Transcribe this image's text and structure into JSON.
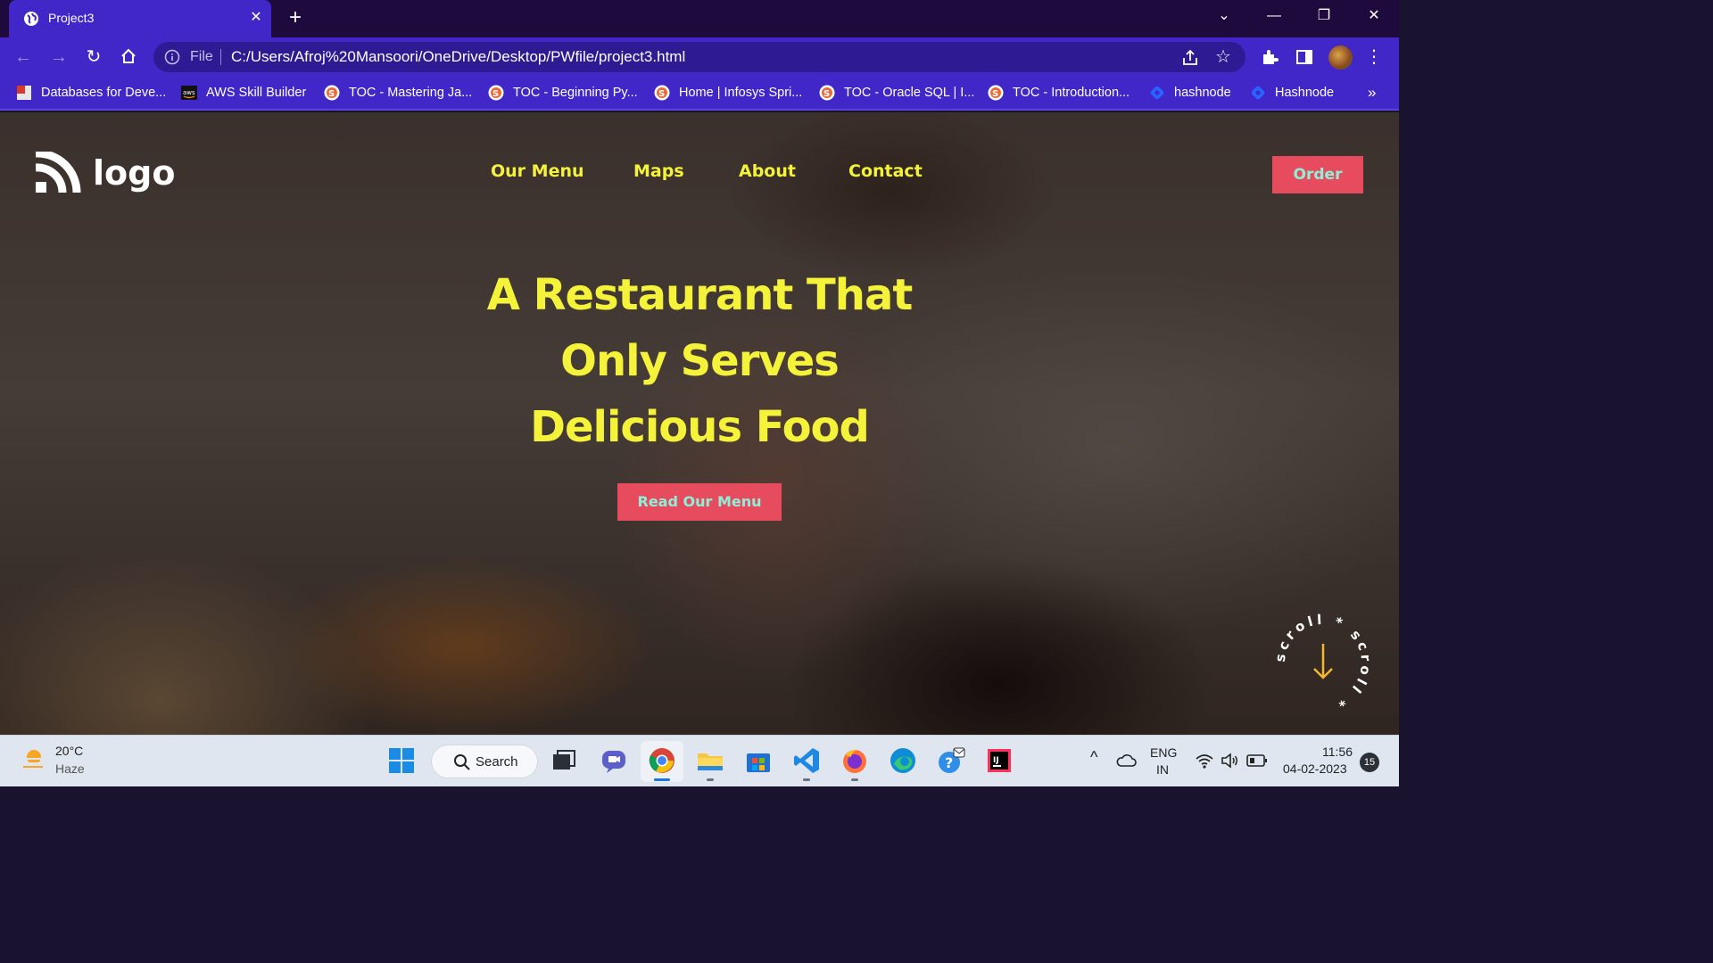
{
  "browser": {
    "tab_title": "Project3",
    "address_prefix": "File",
    "url": "C:/Users/Afroj%20Mansoori/OneDrive/Desktop/PWfile/project3.html",
    "bookmarks": [
      {
        "label": "Databases for Deve...",
        "icon": "pdf-icon"
      },
      {
        "label": "AWS Skill Builder",
        "icon": "aws-icon"
      },
      {
        "label": "TOC - Mastering Ja...",
        "icon": "springboard-icon"
      },
      {
        "label": "TOC - Beginning Py...",
        "icon": "springboard-icon"
      },
      {
        "label": "Home | Infosys Spri...",
        "icon": "springboard-icon"
      },
      {
        "label": "TOC - Oracle SQL | I...",
        "icon": "springboard-icon"
      },
      {
        "label": "TOC - Introduction...",
        "icon": "springboard-icon"
      },
      {
        "label": "hashnode",
        "icon": "hashnode-icon"
      },
      {
        "label": "Hashnode",
        "icon": "hashnode-icon"
      }
    ],
    "more_bookmarks": "»"
  },
  "site": {
    "logo_text": "logo",
    "nav": [
      "Our Menu",
      "Maps",
      "About",
      "Contact"
    ],
    "order_label": "Order",
    "headline_lines": [
      "A Restaurant That",
      "Only Serves",
      "Delicious Food"
    ],
    "cta_label": "Read Our Menu",
    "scroll_text": "scroll * scroll *"
  },
  "colors": {
    "browser_accent": "#4126c8",
    "headline_yellow": "#f5f23a",
    "button_red": "#e74c5e",
    "button_text_mint": "#8ef0d8"
  },
  "taskbar": {
    "weather_temp": "20°C",
    "weather_cond": "Haze",
    "search_label": "Search",
    "lang_top": "ENG",
    "lang_bottom": "IN",
    "time": "11:56",
    "date": "04-02-2023",
    "notification_count": "15"
  }
}
